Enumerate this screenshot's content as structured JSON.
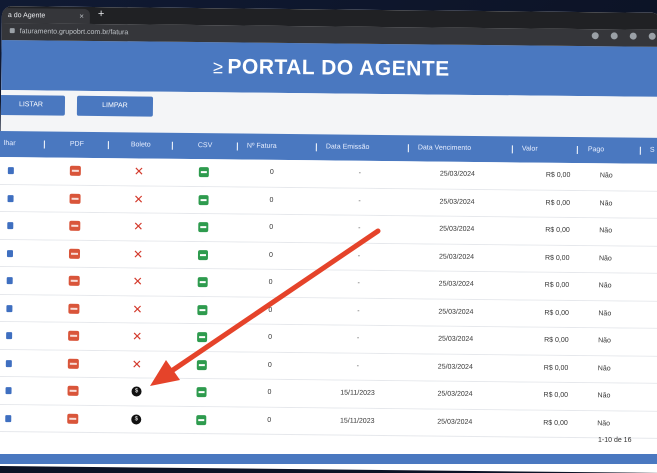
{
  "browser": {
    "tab_title": "a do Agente",
    "tab_close": "×",
    "new_tab": "+",
    "url": "faturamento.grupobrt.com.br/fatura"
  },
  "header": {
    "logo": "≥",
    "title": "PORTAL DO AGENTE"
  },
  "actions": {
    "listar": "LISTAR",
    "limpar": "LIMPAR"
  },
  "table": {
    "columns": [
      "lhar",
      "PDF",
      "Boleto",
      "CSV",
      "Nº Fatura",
      "Data Emissão",
      "Data Vencimento",
      "Valor",
      "Pago",
      "S"
    ],
    "rows": [
      {
        "boleto": "x",
        "fatura": "0",
        "emissao": "-",
        "vencimento": "25/03/2024",
        "valor": "R$ 0,00",
        "pago": "Não"
      },
      {
        "boleto": "x",
        "fatura": "0",
        "emissao": "-",
        "vencimento": "25/03/2024",
        "valor": "R$ 0,00",
        "pago": "Não"
      },
      {
        "boleto": "x",
        "fatura": "0",
        "emissao": "-",
        "vencimento": "25/03/2024",
        "valor": "R$ 0,00",
        "pago": "Não"
      },
      {
        "boleto": "x",
        "fatura": "0",
        "emissao": "-",
        "vencimento": "25/03/2024",
        "valor": "R$ 0,00",
        "pago": "Não"
      },
      {
        "boleto": "x",
        "fatura": "0",
        "emissao": "-",
        "vencimento": "25/03/2024",
        "valor": "R$ 0,00",
        "pago": "Não"
      },
      {
        "boleto": "x",
        "fatura": "0",
        "emissao": "-",
        "vencimento": "25/03/2024",
        "valor": "R$ 0,00",
        "pago": "Não"
      },
      {
        "boleto": "x",
        "fatura": "0",
        "emissao": "-",
        "vencimento": "25/03/2024",
        "valor": "R$ 0,00",
        "pago": "Não"
      },
      {
        "boleto": "x",
        "fatura": "0",
        "emissao": "-",
        "vencimento": "25/03/2024",
        "valor": "R$ 0,00",
        "pago": "Não"
      },
      {
        "boleto": "$",
        "fatura": "0",
        "emissao": "15/11/2023",
        "vencimento": "25/03/2024",
        "valor": "R$ 0,00",
        "pago": "Não"
      },
      {
        "boleto": "$",
        "fatura": "0",
        "emissao": "15/11/2023",
        "vencimento": "25/03/2024",
        "valor": "R$ 0,00",
        "pago": "Não"
      }
    ],
    "pagination": "1-10 de 16"
  },
  "colors": {
    "primary": "#4a78c0",
    "arrow": "#e5432a",
    "pdf": "#d9553a",
    "csv": "#2e9b4e",
    "x": "#d33a2c"
  },
  "icons": [
    "detail-icon",
    "pdf-icon",
    "cancel-x-icon",
    "boleto-dollar-icon",
    "csv-icon"
  ]
}
